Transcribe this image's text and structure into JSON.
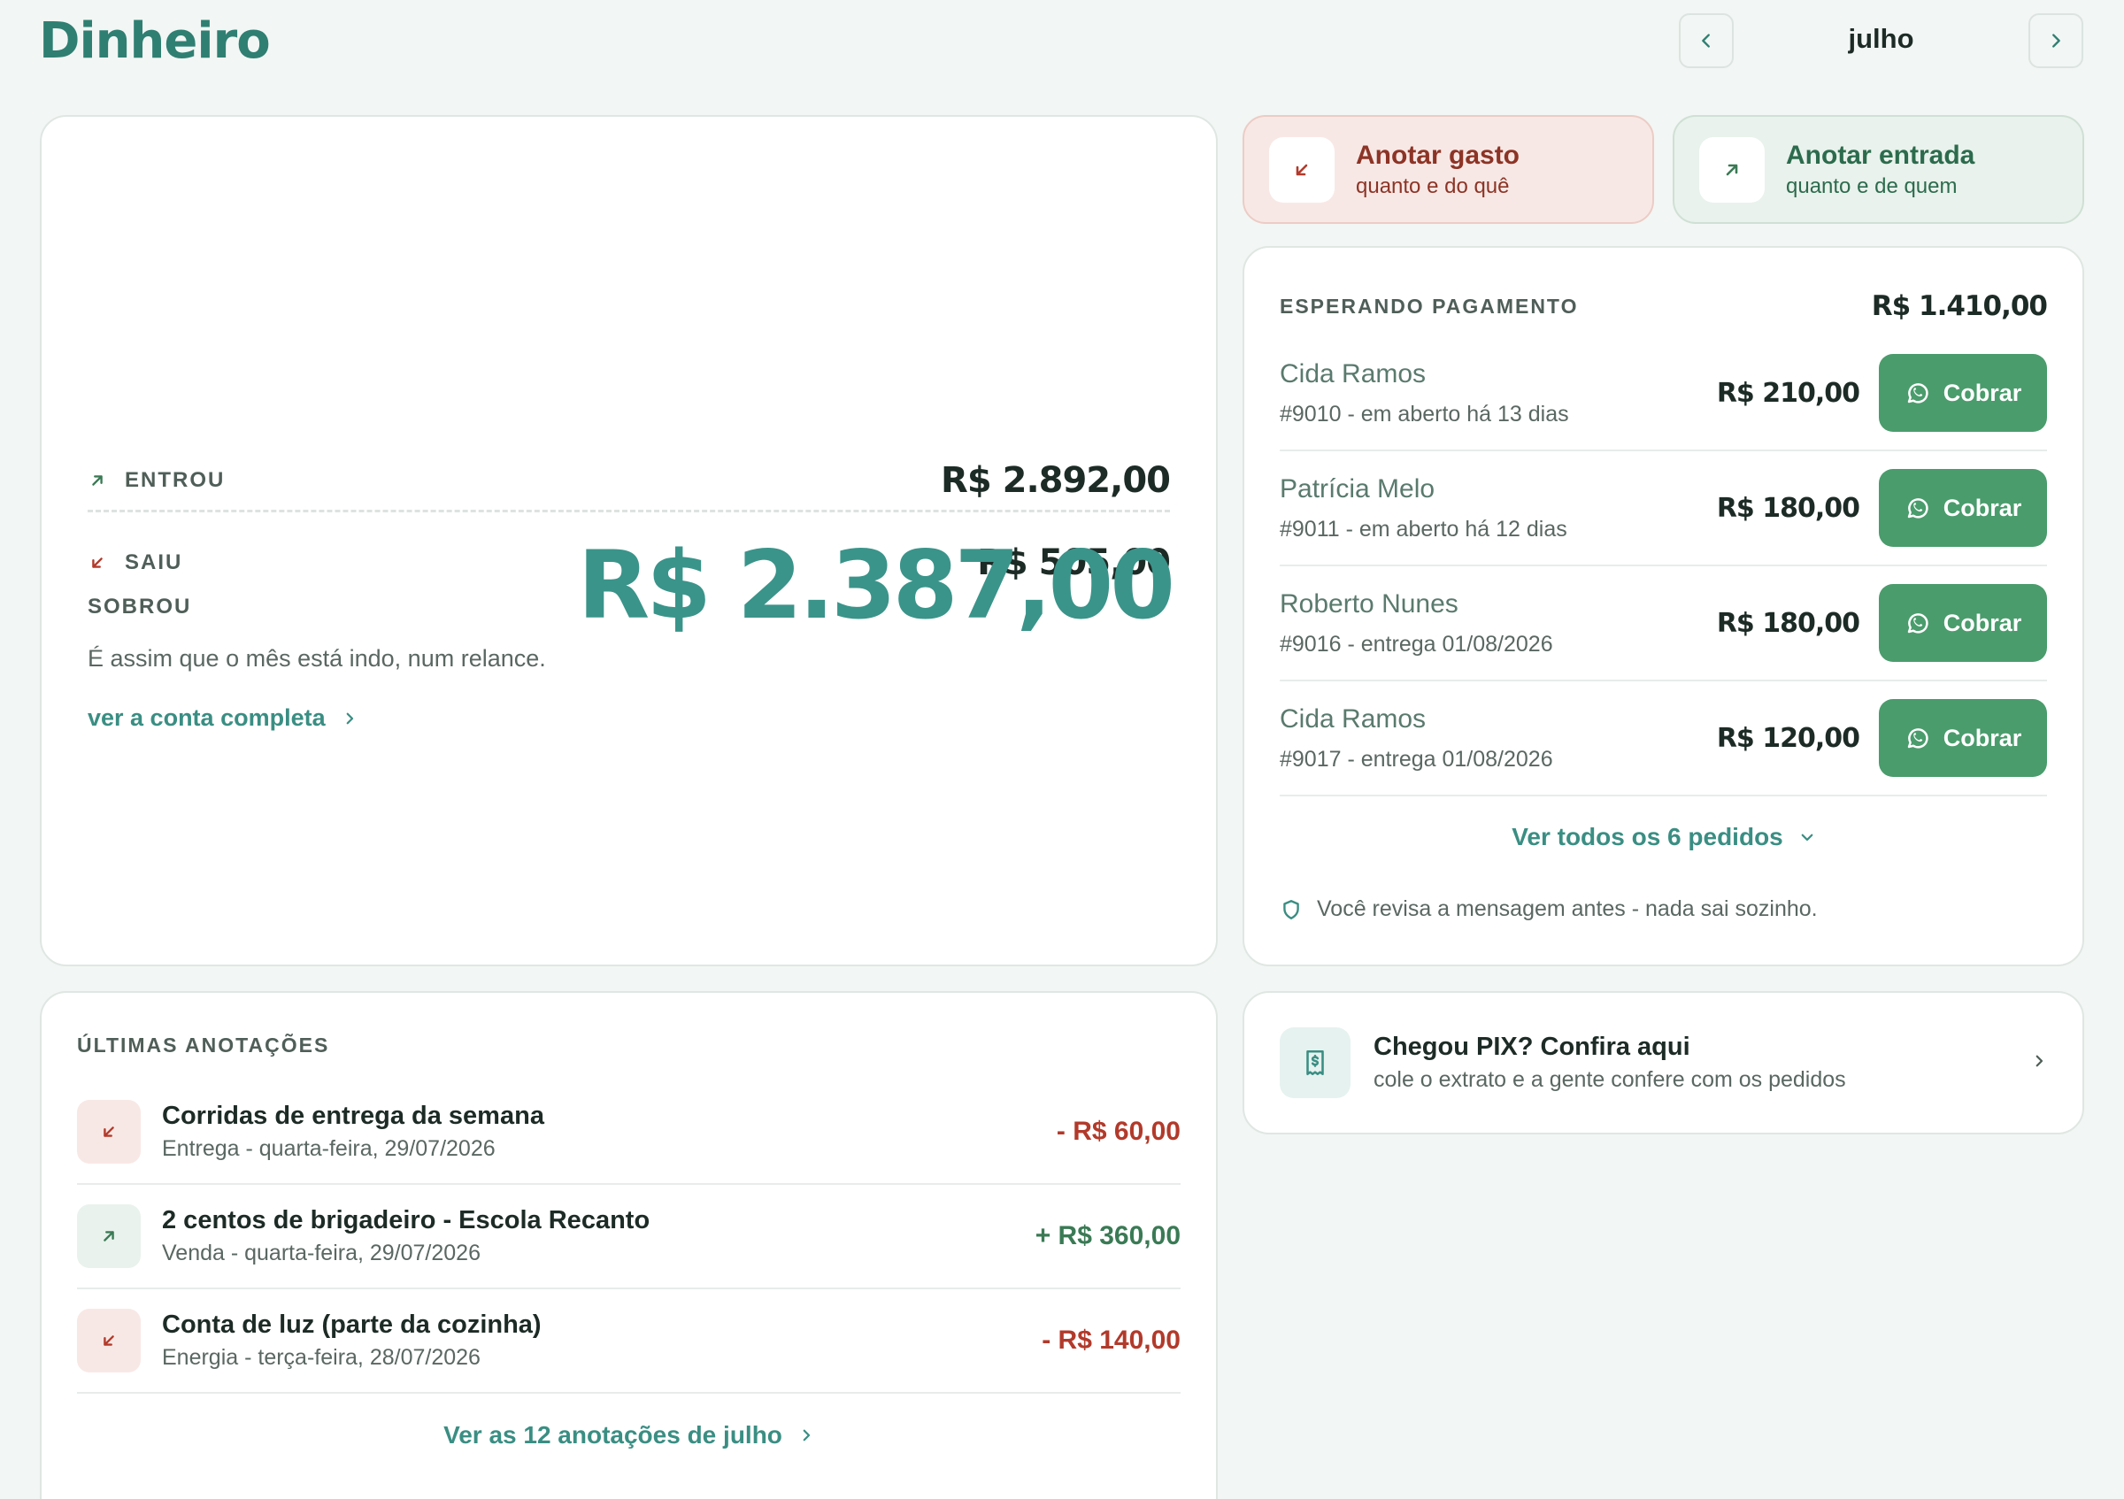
{
  "header": {
    "brand": "Dinheiro",
    "month": "julho",
    "prev_icon": "chevron-left-icon",
    "next_icon": "chevron-right-icon"
  },
  "summary": {
    "in_label": "ENTROU",
    "in_value": "R$ 2.892,00",
    "out_label": "SAIU",
    "out_value": "R$ 505,00",
    "left_label": "SOBROU",
    "left_value": "R$ 2.387,00",
    "tagline": "É assim que o mês está indo, num relance.",
    "link": "ver a conta completa"
  },
  "actions": {
    "expense": {
      "title": "Anotar gasto",
      "subtitle": "quanto e do quê",
      "icon": "arrow-down-left-icon"
    },
    "income": {
      "title": "Anotar entrada",
      "subtitle": "quanto e de quem",
      "icon": "arrow-up-right-icon"
    }
  },
  "pending": {
    "label": "ESPERANDO PAGAMENTO",
    "total": "R$ 1.410,00",
    "button_label": "Cobrar",
    "items": [
      {
        "name": "Cida Ramos",
        "meta": "#9010 - em aberto há 13 dias",
        "amount": "R$ 210,00"
      },
      {
        "name": "Patrícia Melo",
        "meta": "#9011 - em aberto há 12 dias",
        "amount": "R$ 180,00"
      },
      {
        "name": "Roberto Nunes",
        "meta": "#9016 - entrega 01/08/2026",
        "amount": "R$ 180,00"
      },
      {
        "name": "Cida Ramos",
        "meta": "#9017 - entrega 01/08/2026",
        "amount": "R$ 120,00"
      }
    ],
    "see_all": "Ver todos os 6 pedidos",
    "safe_note": "Você revisa a mensagem antes - nada sai sozinho."
  },
  "notes": {
    "label": "ÚLTIMAS ANOTAÇÕES",
    "items": [
      {
        "title": "Corridas de entrega da semana",
        "sub": "Entrega - quarta-feira, 29/07/2026",
        "amount": "- R$ 60,00",
        "kind": "out"
      },
      {
        "title": "2 centos de brigadeiro - Escola Recanto",
        "sub": "Venda - quarta-feira, 29/07/2026",
        "amount": "+ R$ 360,00",
        "kind": "in"
      },
      {
        "title": "Conta de luz (parte da cozinha)",
        "sub": "Energia - terça-feira, 28/07/2026",
        "amount": "- R$ 140,00",
        "kind": "out"
      }
    ],
    "more": "Ver as 12 anotações de julho"
  },
  "pix": {
    "title": "Chegou PIX? Confira aqui",
    "subtitle": "cole o extrato e a gente confere com os pedidos",
    "icon": "receipt-icon"
  },
  "colors": {
    "brand": "#2f7f72",
    "accent": "#3a948a",
    "expense": "#b23a2b",
    "income": "#3a7a55",
    "whatsapp_button": "#4a9c6c"
  }
}
